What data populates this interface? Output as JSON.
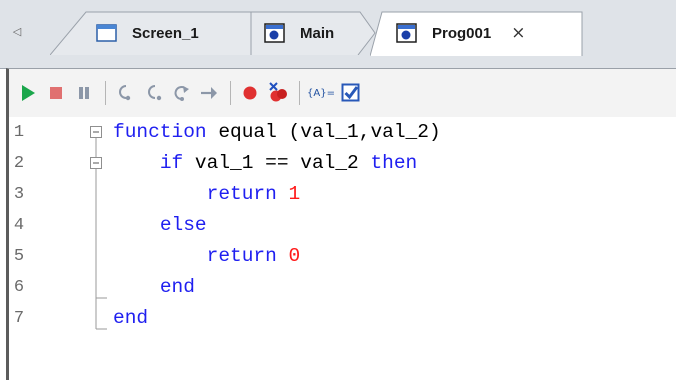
{
  "tabs": [
    {
      "label": "Screen_1",
      "icon": "screen-icon",
      "active": false
    },
    {
      "label": "Main",
      "icon": "program-icon",
      "active": false
    },
    {
      "label": "Prog001",
      "icon": "program-icon",
      "active": true,
      "close": "×"
    }
  ],
  "tab_scroll_glyph": "◁",
  "toolbar": {
    "buttons": [
      "run-icon",
      "stop-icon",
      "pause-icon",
      "step-into-icon",
      "step-over-icon",
      "step-out-icon",
      "run-to-cursor-icon",
      "breakpoint-icon",
      "clear-breakpoints-icon",
      "watch-variable-icon",
      "checkbox-icon"
    ],
    "watch_label": "{A}="
  },
  "code": {
    "line_numbers": [
      "1",
      "2",
      "3",
      "4",
      "5",
      "6",
      "7"
    ],
    "lines": [
      {
        "indent": "",
        "parts": [
          [
            "kw",
            "function"
          ],
          [
            "t",
            " equal (val_1,val_2)"
          ]
        ]
      },
      {
        "indent": "    ",
        "parts": [
          [
            "kw",
            "if"
          ],
          [
            "t",
            " val_1 == val_2 "
          ],
          [
            "kw",
            "then"
          ]
        ]
      },
      {
        "indent": "        ",
        "parts": [
          [
            "kw",
            "return"
          ],
          [
            "t",
            " "
          ],
          [
            "num",
            "1"
          ]
        ]
      },
      {
        "indent": "    ",
        "parts": [
          [
            "kw",
            "else"
          ]
        ]
      },
      {
        "indent": "        ",
        "parts": [
          [
            "kw",
            "return"
          ],
          [
            "t",
            " "
          ],
          [
            "num",
            "0"
          ]
        ]
      },
      {
        "indent": "    ",
        "parts": [
          [
            "kw",
            "end"
          ]
        ]
      },
      {
        "indent": "",
        "parts": [
          [
            "kw",
            "end"
          ]
        ]
      }
    ]
  },
  "colors": {
    "keyword": "#1f1ff0",
    "number": "#ff1a1a",
    "run": "#1aa64b",
    "stop": "#e03030"
  }
}
